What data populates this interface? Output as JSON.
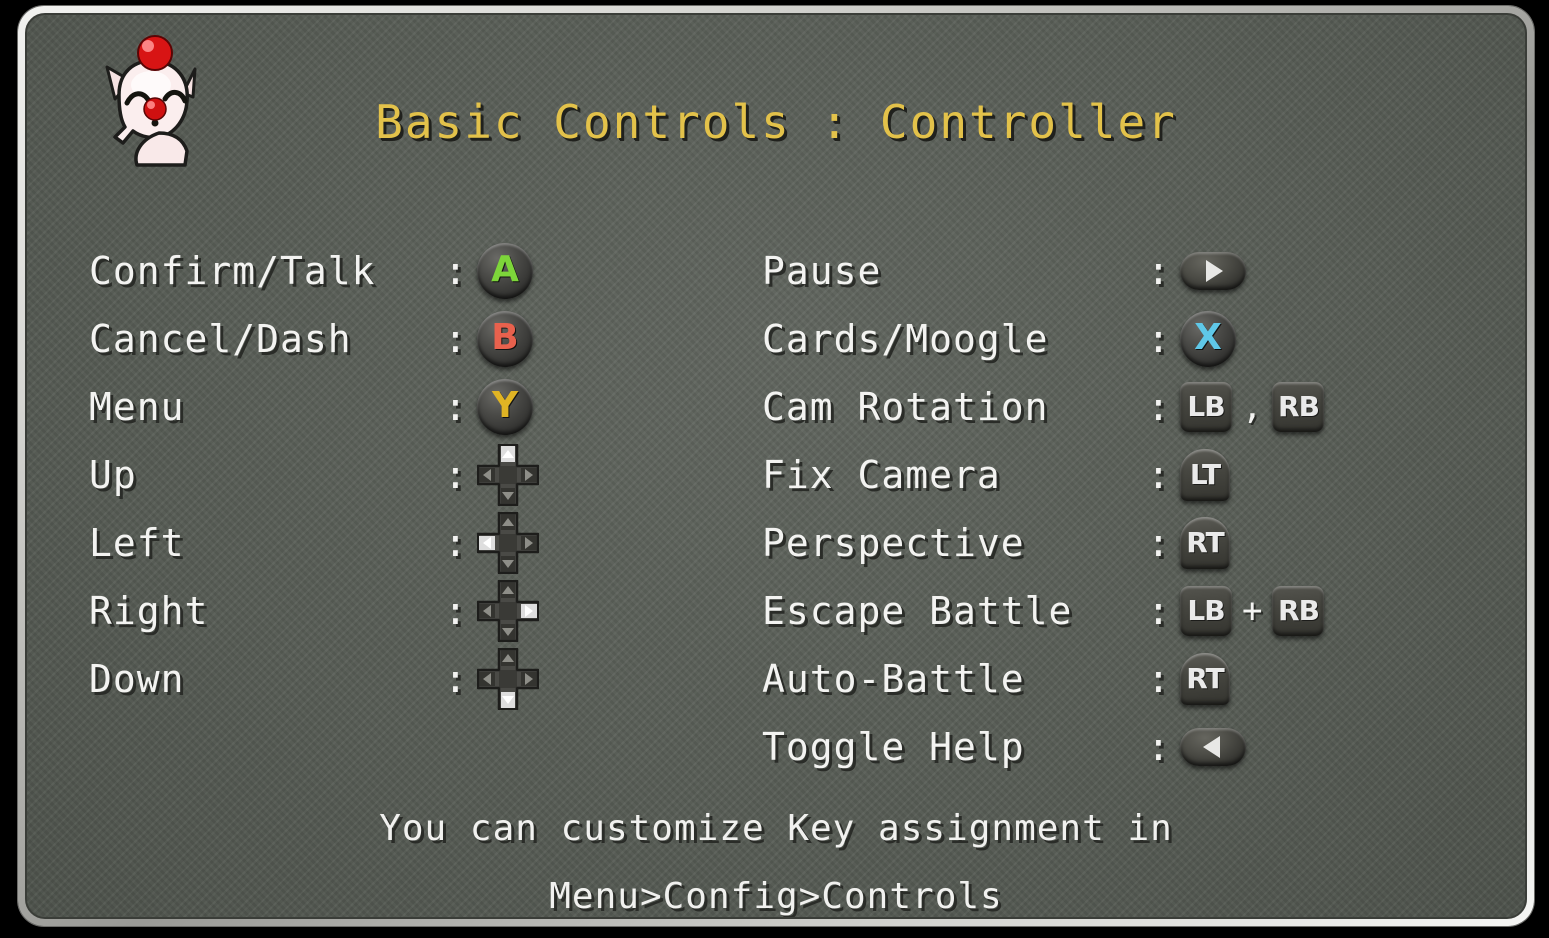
{
  "window": {
    "title": "Basic Controls : Controller",
    "mascot_icon": "moogle-icon",
    "background_color": "#5a5f58",
    "title_color": "#e3c24a",
    "text_color": "#f3f3f1",
    "separator": ":"
  },
  "left_column": [
    {
      "label": "Confirm/Talk",
      "colon": ":",
      "keys": [
        {
          "type": "face",
          "glyph": "A",
          "color": "#7dd63a",
          "icon_name": "button-a-icon"
        }
      ]
    },
    {
      "label": "Cancel/Dash",
      "colon": ":",
      "keys": [
        {
          "type": "face",
          "glyph": "B",
          "color": "#e8614d",
          "icon_name": "button-b-icon"
        }
      ]
    },
    {
      "label": "Menu",
      "colon": ":",
      "keys": [
        {
          "type": "face",
          "glyph": "Y",
          "color": "#e0b424",
          "icon_name": "button-y-icon"
        }
      ]
    },
    {
      "label": "Up",
      "colon": ":",
      "keys": [
        {
          "type": "dpad",
          "direction": "up",
          "icon_name": "dpad-up-icon"
        }
      ]
    },
    {
      "label": "Left",
      "colon": ":",
      "keys": [
        {
          "type": "dpad",
          "direction": "left",
          "icon_name": "dpad-left-icon"
        }
      ]
    },
    {
      "label": "Right",
      "colon": ":",
      "keys": [
        {
          "type": "dpad",
          "direction": "right",
          "icon_name": "dpad-right-icon"
        }
      ]
    },
    {
      "label": "Down",
      "colon": ":",
      "keys": [
        {
          "type": "dpad",
          "direction": "down",
          "icon_name": "dpad-down-icon"
        }
      ]
    }
  ],
  "right_column": [
    {
      "label": "Pause",
      "colon": ":",
      "keys": [
        {
          "type": "pill",
          "arrow": "right",
          "icon_name": "start-button-icon"
        }
      ]
    },
    {
      "label": "Cards/Moogle",
      "colon": ":",
      "keys": [
        {
          "type": "face",
          "glyph": "X",
          "color": "#5fc8e8",
          "icon_name": "button-x-icon"
        }
      ]
    },
    {
      "label": "Cam Rotation",
      "colon": ":",
      "keys": [
        {
          "type": "shoulder",
          "glyph": "LB",
          "icon_name": "button-lb-icon"
        },
        {
          "type": "sep",
          "text": ","
        },
        {
          "type": "shoulder",
          "glyph": "RB",
          "icon_name": "button-rb-icon"
        }
      ]
    },
    {
      "label": "Fix Camera",
      "colon": ":",
      "keys": [
        {
          "type": "trigger",
          "glyph": "LT",
          "icon_name": "button-lt-icon"
        }
      ]
    },
    {
      "label": "Perspective",
      "colon": ":",
      "keys": [
        {
          "type": "trigger",
          "glyph": "RT",
          "icon_name": "button-rt-icon"
        }
      ]
    },
    {
      "label": "Escape Battle",
      "colon": ":",
      "keys": [
        {
          "type": "shoulder",
          "glyph": "LB",
          "icon_name": "button-lb-icon"
        },
        {
          "type": "sep",
          "text": "+"
        },
        {
          "type": "shoulder",
          "glyph": "RB",
          "icon_name": "button-rb-icon"
        }
      ]
    },
    {
      "label": "Auto-Battle",
      "colon": ":",
      "keys": [
        {
          "type": "trigger",
          "glyph": "RT",
          "icon_name": "button-rt-icon"
        }
      ]
    },
    {
      "label": "Toggle Help",
      "colon": ":",
      "keys": [
        {
          "type": "pill",
          "arrow": "left",
          "icon_name": "back-button-icon"
        }
      ]
    }
  ],
  "footer": [
    "You can customize Key assignment in",
    "Menu>Config>Controls"
  ]
}
